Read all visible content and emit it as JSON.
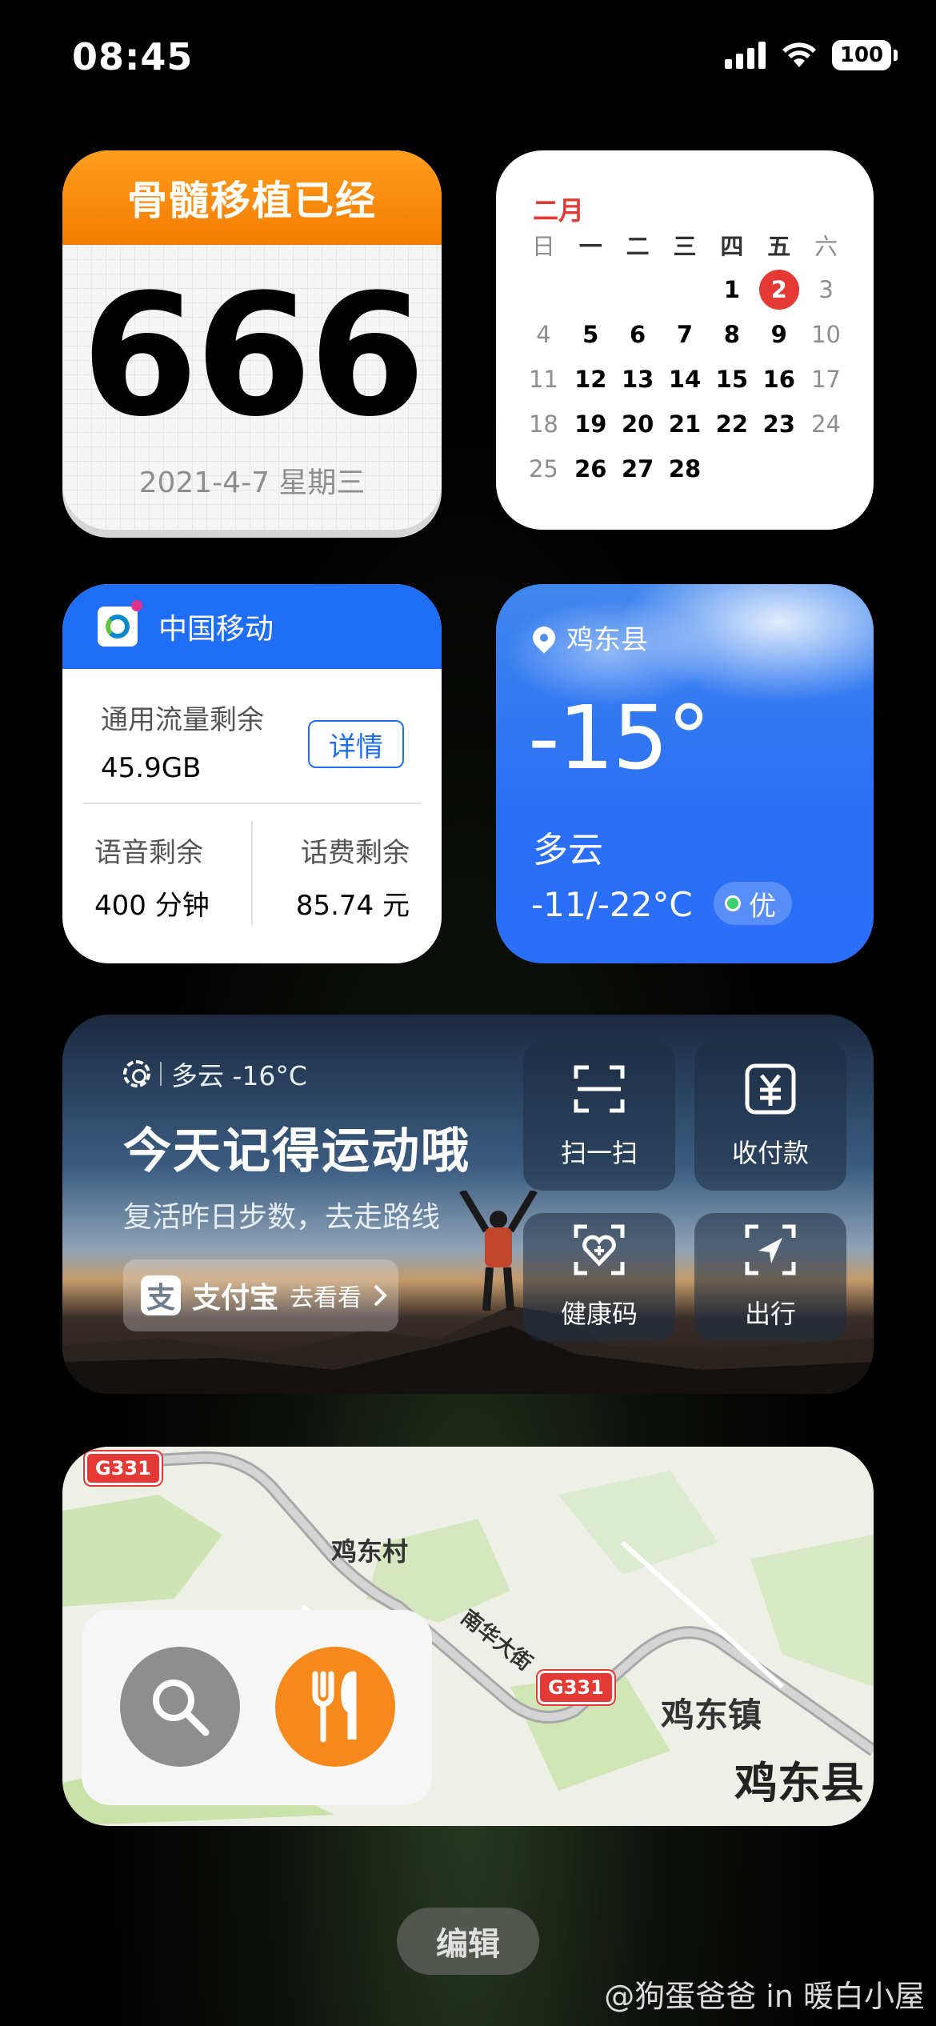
{
  "status_bar": {
    "time": "08:45",
    "battery": "100"
  },
  "countdown": {
    "title": "骨髓移植已经",
    "days": "666",
    "date": "2021-4-7 星期三"
  },
  "calendar": {
    "month": "二月",
    "weekdays": [
      "日",
      "一",
      "二",
      "三",
      "四",
      "五",
      "六"
    ],
    "today": "2",
    "days": [
      "",
      "",
      "",
      "",
      "1",
      "2",
      "3",
      "4",
      "5",
      "6",
      "7",
      "8",
      "9",
      "10",
      "11",
      "12",
      "13",
      "14",
      "15",
      "16",
      "17",
      "18",
      "19",
      "20",
      "21",
      "22",
      "23",
      "24",
      "25",
      "26",
      "27",
      "28"
    ]
  },
  "carrier": {
    "name": "中国移动",
    "data_label": "通用流量剩余",
    "data_value": "45.9GB",
    "detail_button": "详情",
    "voice_label": "语音剩余",
    "voice_value": "400 分钟",
    "fee_label": "话费剩余",
    "fee_value": "85.74 元"
  },
  "weather": {
    "location": "鸡东县",
    "temperature": "-15°",
    "condition": "多云",
    "range": "-11/-22°C",
    "aqi": "优"
  },
  "alipay": {
    "weather": "多云 -16°C",
    "title": "今天记得运动哦",
    "subtitle": "复活昨日步数，去走路线",
    "brand": "支付宝",
    "brand_logo": "支",
    "go_label": "去看看",
    "tiles": [
      {
        "label": "扫一扫",
        "icon": "scan-icon"
      },
      {
        "label": "收付款",
        "icon": "payment-icon"
      },
      {
        "label": "健康码",
        "icon": "health-code-icon"
      },
      {
        "label": "出行",
        "icon": "travel-icon"
      }
    ]
  },
  "map": {
    "labels": {
      "village": "鸡东村",
      "street": "南华大街",
      "town": "鸡东镇",
      "county": "鸡东县"
    },
    "road_shield": "G331"
  },
  "edit_button": "编辑",
  "watermark": "@狗蛋爸爸 in 暖白小屋"
}
